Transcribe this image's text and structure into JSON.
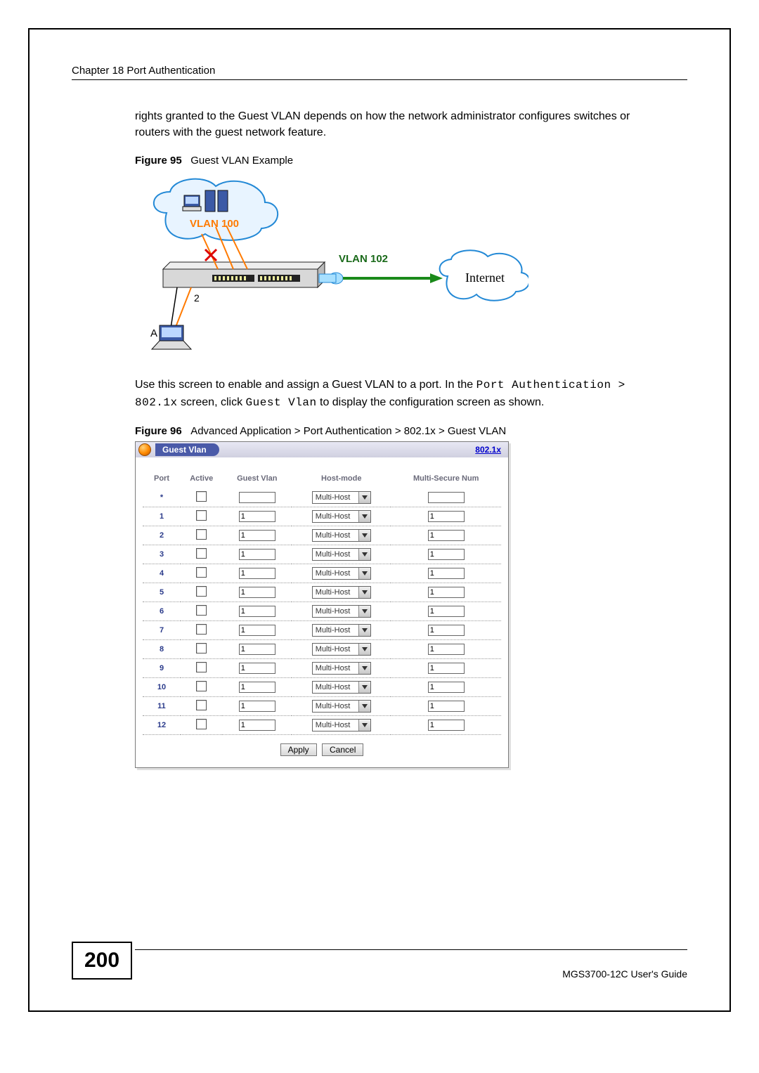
{
  "header": {
    "chapter": "Chapter 18 Port Authentication"
  },
  "para1": "rights granted to the Guest VLAN depends on how the network administrator configures switches or routers with the guest network feature.",
  "fig95": {
    "label": "Figure 95",
    "title": "Guest VLAN Example"
  },
  "diagram": {
    "vlan100": "VLAN 100",
    "vlan102": "VLAN 102",
    "internet": "Internet",
    "port2": "2",
    "hostA": "A"
  },
  "para2_a": "Use this screen to enable and assign a Guest VLAN to a port. In the ",
  "para2_nav1": "Port Authentication > 802.1x",
  "para2_b": " screen, click ",
  "para2_nav2": "Guest Vlan",
  "para2_c": " to display the configuration screen as shown.",
  "fig96": {
    "label": "Figure 96",
    "title": "Advanced Application > Port Authentication > 802.1x > Guest VLAN"
  },
  "ui": {
    "title": "Guest Vlan",
    "link": "802.1x",
    "headers": {
      "port": "Port",
      "active": "Active",
      "gv": "Guest Vlan",
      "hm": "Host-mode",
      "msn": "Multi-Secure Num"
    },
    "hostmode": "Multi-Host",
    "rows": [
      {
        "port": "*",
        "gv": "",
        "msn": ""
      },
      {
        "port": "1",
        "gv": "1",
        "msn": "1"
      },
      {
        "port": "2",
        "gv": "1",
        "msn": "1"
      },
      {
        "port": "3",
        "gv": "1",
        "msn": "1"
      },
      {
        "port": "4",
        "gv": "1",
        "msn": "1"
      },
      {
        "port": "5",
        "gv": "1",
        "msn": "1"
      },
      {
        "port": "6",
        "gv": "1",
        "msn": "1"
      },
      {
        "port": "7",
        "gv": "1",
        "msn": "1"
      },
      {
        "port": "8",
        "gv": "1",
        "msn": "1"
      },
      {
        "port": "9",
        "gv": "1",
        "msn": "1"
      },
      {
        "port": "10",
        "gv": "1",
        "msn": "1"
      },
      {
        "port": "11",
        "gv": "1",
        "msn": "1"
      },
      {
        "port": "12",
        "gv": "1",
        "msn": "1"
      }
    ],
    "apply": "Apply",
    "cancel": "Cancel"
  },
  "footer": {
    "page": "200",
    "guide": "MGS3700-12C User's Guide"
  }
}
